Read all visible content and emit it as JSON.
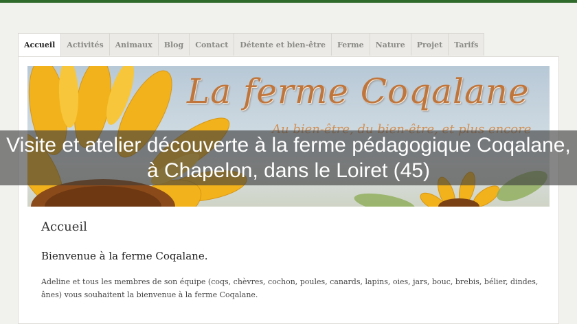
{
  "nav": {
    "tabs": [
      {
        "label": "Accueil"
      },
      {
        "label": "Activités"
      },
      {
        "label": "Animaux"
      },
      {
        "label": "Blog"
      },
      {
        "label": "Contact"
      },
      {
        "label": "Détente et bien-être"
      },
      {
        "label": "Ferme"
      },
      {
        "label": "Nature"
      },
      {
        "label": "Projet"
      },
      {
        "label": "Tarifs"
      }
    ],
    "active": "Accueil"
  },
  "banner": {
    "title": "La ferme Coqalane",
    "subtitle": "Au bien-être, du bien-être, et plus encore"
  },
  "overlay": {
    "caption": "Visite et atelier découverte à la ferme pédagogique Coqalane, à Chapelon, dans le Loiret (45)"
  },
  "content": {
    "page_title": "Accueil",
    "welcome": "Bienvenue à la ferme Coqalane.",
    "paragraph": "Adeline et tous les membres de son équipe (coqs, chèvres, cochon, poules, canards, lapins, oies, jars, bouc, brebis, bélier, dindes, ânes) vous souhaitent la bienvenue à la ferme Coqalane."
  },
  "colors": {
    "top_bar": "#2f6b2a",
    "banner_title": "#c0753b",
    "sunflower": "#f2b21c"
  }
}
